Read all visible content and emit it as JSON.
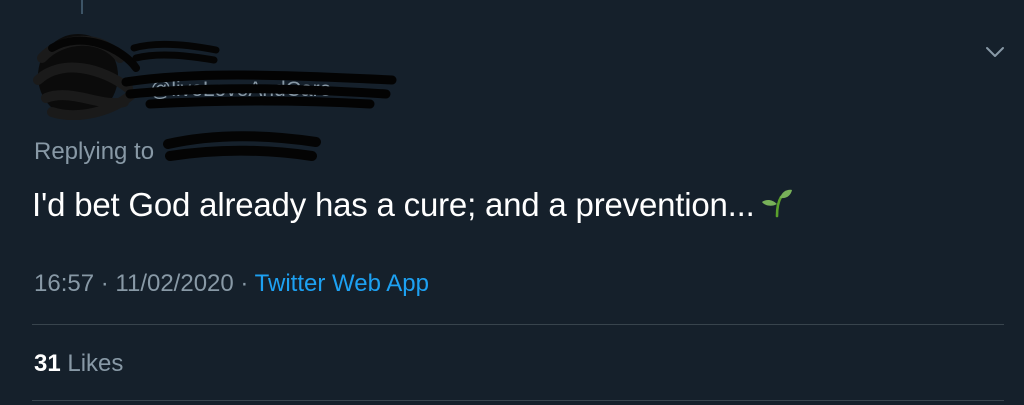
{
  "tweet": {
    "handle_partial": "@liveLoveAndCare",
    "replying_label": "Replying to",
    "text": "I'd bet God already has a cure; and a prevention...",
    "emoji": "seedling-icon",
    "time": "16:57",
    "date": "11/02/2020",
    "separator": "·",
    "app": "Twitter Web App",
    "likes_count": "31",
    "likes_label": "Likes"
  },
  "colors": {
    "background": "#15202b",
    "secondary_text": "#8899a6",
    "accent": "#1da1f2",
    "divider": "#38444d"
  }
}
